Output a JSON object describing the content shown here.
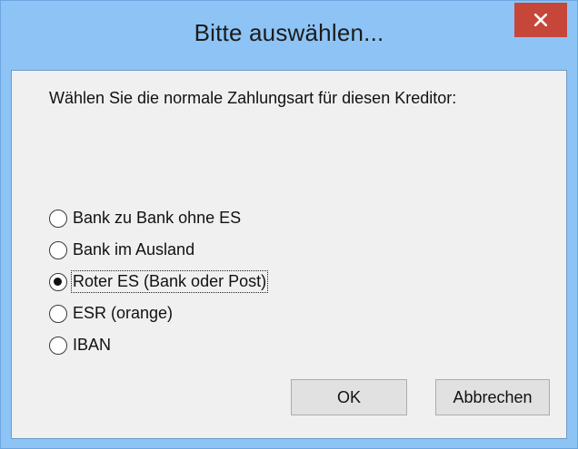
{
  "window": {
    "title": "Bitte auswählen...",
    "close_icon": "close-icon"
  },
  "dialog": {
    "prompt": "Wählen Sie die normale Zahlungsart für diesen Kreditor:",
    "options": [
      {
        "label": "Bank zu Bank ohne ES",
        "selected": false
      },
      {
        "label": "Bank im Ausland",
        "selected": false
      },
      {
        "label": "Roter ES (Bank oder Post)",
        "selected": true
      },
      {
        "label": "ESR (orange)",
        "selected": false
      },
      {
        "label": "IBAN",
        "selected": false
      }
    ],
    "ok_label": "OK",
    "cancel_label": "Abbrechen"
  },
  "colors": {
    "title_bar": "#8ec4f5",
    "close_button": "#c7463a",
    "client_background": "#f0f0f0"
  }
}
